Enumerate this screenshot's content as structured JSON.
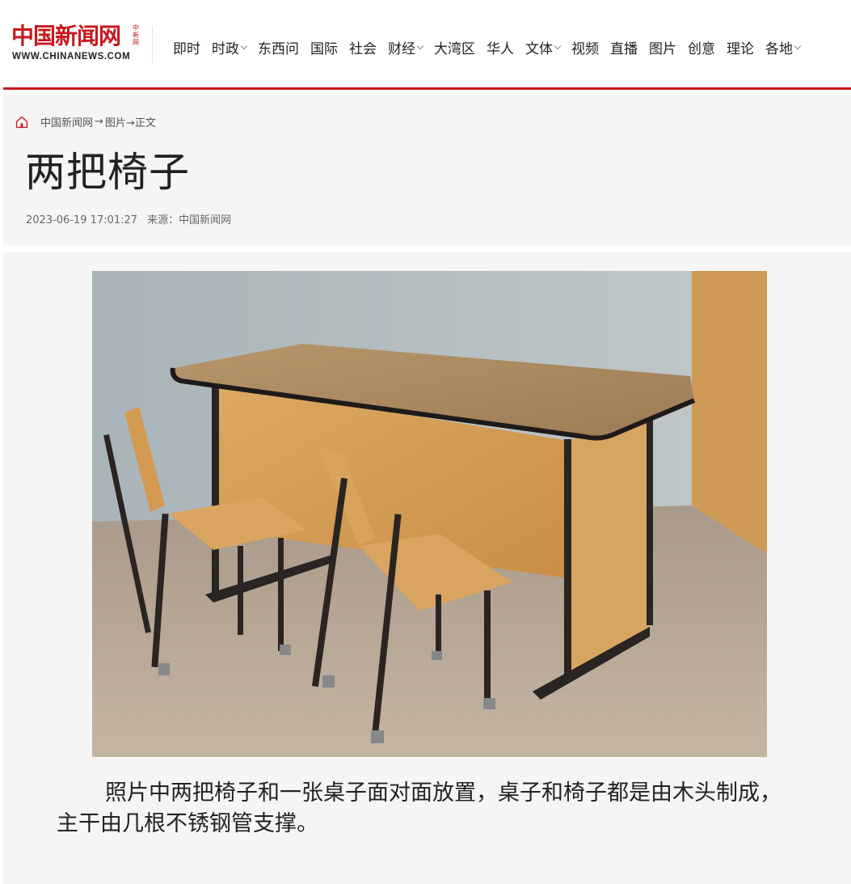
{
  "header": {
    "logo_main": "中国新闻网",
    "logo_side": "中新网",
    "logo_url": "WWW.CHINANEWS.COM",
    "nav": [
      {
        "label": "即时",
        "dropdown": false
      },
      {
        "label": "时政",
        "dropdown": true
      },
      {
        "label": "东西问",
        "dropdown": false
      },
      {
        "label": "国际",
        "dropdown": false
      },
      {
        "label": "社会",
        "dropdown": false
      },
      {
        "label": "财经",
        "dropdown": true
      },
      {
        "label": "大湾区",
        "dropdown": false
      },
      {
        "label": "华人",
        "dropdown": false
      },
      {
        "label": "文体",
        "dropdown": true
      },
      {
        "label": "视频",
        "dropdown": false
      },
      {
        "label": "直播",
        "dropdown": false
      },
      {
        "label": "图片",
        "dropdown": false
      },
      {
        "label": "创意",
        "dropdown": false
      },
      {
        "label": "理论",
        "dropdown": false
      },
      {
        "label": "各地",
        "dropdown": true
      }
    ]
  },
  "breadcrumb": {
    "home": "中国新闻网",
    "sep": "→",
    "section": "图片→正文"
  },
  "article": {
    "title": "两把椅子",
    "datetime": "2023-06-19 17:01:27",
    "source": "来源：中国新闻网",
    "caption": "照片中两把椅子和一张桌子面对面放置，桌子和椅子都是由木头制成，主干由几根不锈钢管支撑。"
  },
  "colors": {
    "brand_red": "#c8161d",
    "panel_bg": "#f5f5f5"
  }
}
